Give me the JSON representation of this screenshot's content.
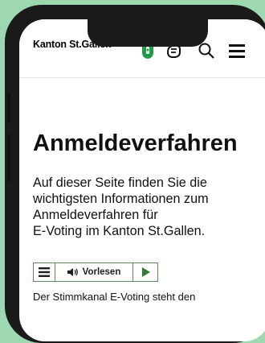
{
  "header": {
    "brand": "Kanton St.Gallen",
    "icons": [
      "coat-of-arms-icon",
      "sign-language-icon",
      "search-icon",
      "menu-icon"
    ]
  },
  "main": {
    "title": "Anmeldeverfahren",
    "intro_lines": [
      "Auf dieser Seite finden Sie die",
      "wichtigsten Informationen zum",
      "Anmeldeverfahren für",
      "E-Voting im Kanton St.Gallen."
    ],
    "readspeaker": {
      "read_label": "Vorlesen",
      "icons": [
        "menu-icon",
        "speaker-icon",
        "play-icon"
      ]
    },
    "body_text": "Der Stimmkanal E-Voting steht den"
  },
  "colors": {
    "background": "#9ed8b0",
    "crest_green": "#1f9a45",
    "toolbar_border": "#5b8c5a",
    "play_green": "#2e7d32"
  }
}
